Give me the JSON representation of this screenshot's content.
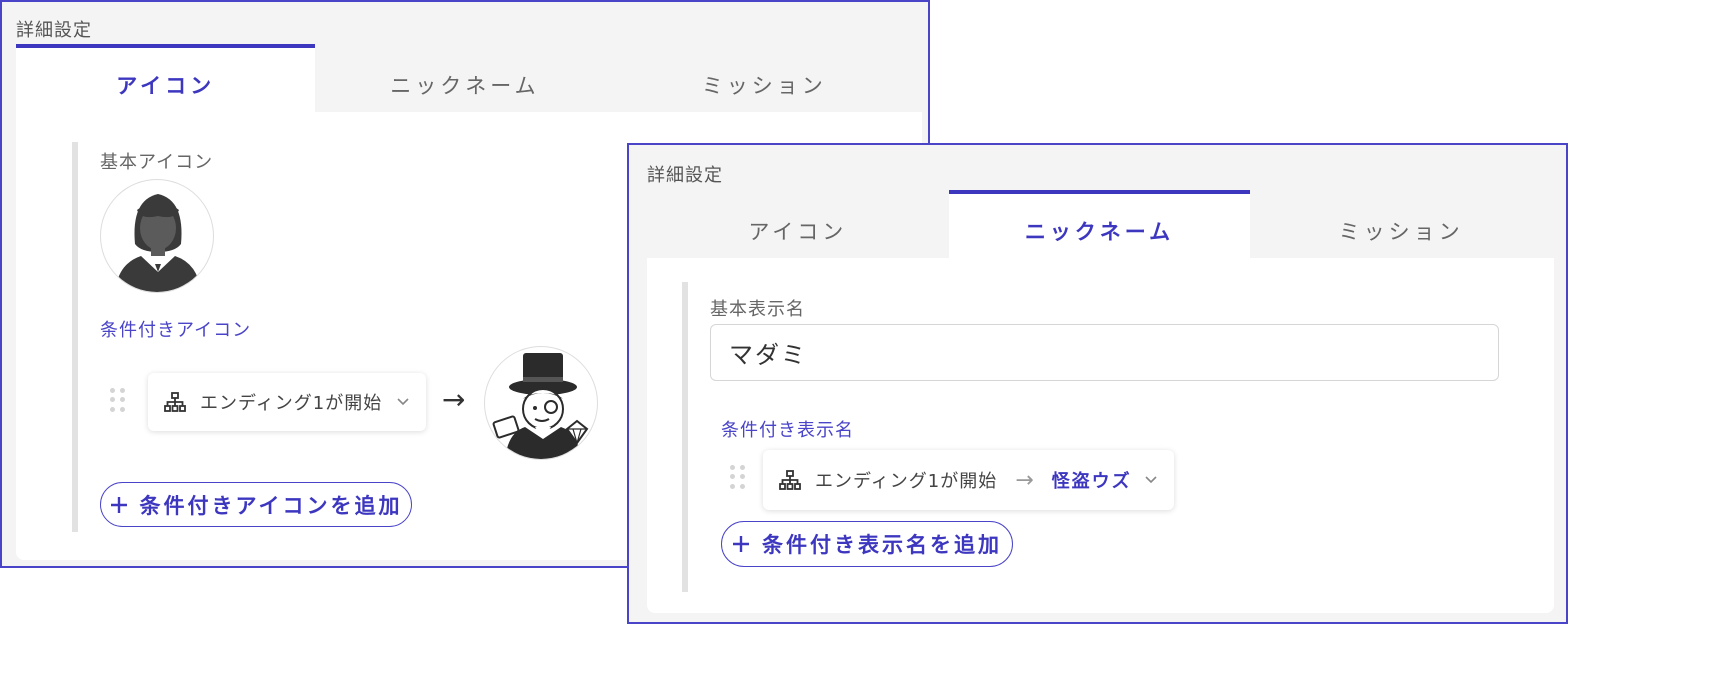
{
  "panel1": {
    "title": "詳細設定",
    "tabs": [
      "アイコン",
      "ニックネーム",
      "ミッション"
    ],
    "active_tab": 0,
    "basic_icon_label": "基本アイコン",
    "conditional_icon_label": "条件付きアイコン",
    "condition": "エンディング1が開始",
    "arrow": "→",
    "add_button": "条件付きアイコンを追加"
  },
  "panel2": {
    "title": "詳細設定",
    "tabs": [
      "アイコン",
      "ニックネーム",
      "ミッション"
    ],
    "active_tab": 1,
    "basic_name_label": "基本表示名",
    "basic_name_value": "マダミ",
    "conditional_name_label": "条件付き表示名",
    "condition": "エンディング1が開始",
    "arrow": "→",
    "result_name": "怪盗ウズ",
    "add_button": "条件付き表示名を追加"
  },
  "colors": {
    "accent": "#3d37c0",
    "border": "#4a44c8",
    "panel_bg": "#f4f4f4"
  }
}
